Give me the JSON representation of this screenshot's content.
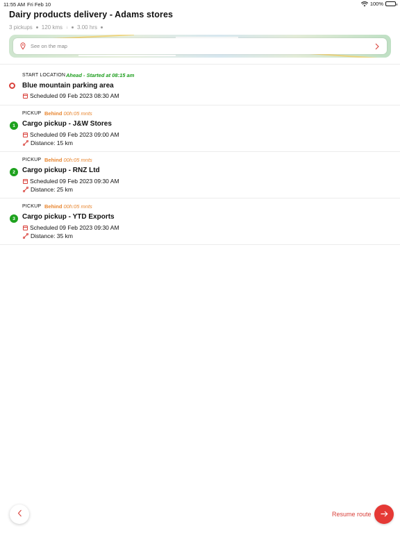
{
  "status_bar": {
    "time": "11:55 AM",
    "date": "Fri Feb 10",
    "battery": "100%"
  },
  "header": {
    "title": "Dairy products delivery - Adams stores",
    "pickups": "3 pickups",
    "distance": "120 kms",
    "duration": "3.00 hrs"
  },
  "map": {
    "placeholder": "See on the map"
  },
  "start": {
    "label": "START LOCATION",
    "status": "Ahead - Started at 08:15 am",
    "title": "Blue mountain parking area",
    "scheduled": "Scheduled 09 Feb 2023 08:30 AM"
  },
  "stops": [
    {
      "number": "1",
      "label": "PICKUP",
      "status_word": "Behind",
      "status_time": "00h:05 mnts",
      "title": "Cargo pickup - J&W Stores",
      "scheduled": "Scheduled 09 Feb 2023 09:00 AM",
      "distance": "Distance: 15 km"
    },
    {
      "number": "2",
      "label": "PICKUP",
      "status_word": "Behind",
      "status_time": "00h:05 mnts",
      "title": "Cargo pickup - RNZ Ltd",
      "scheduled": "Scheduled 09 Feb 2023 09:30 AM",
      "distance": "Distance: 25 km"
    },
    {
      "number": "3",
      "label": "PICKUP",
      "status_word": "Behind",
      "status_time": "00h:05 mnts",
      "title": "Cargo pickup - YTD Exports",
      "scheduled": "Scheduled 09 Feb 2023 09:30 AM",
      "distance": "Distance: 35 km"
    }
  ],
  "footer": {
    "resume_label": "Resume route"
  },
  "colors": {
    "accent": "#e53935",
    "ahead": "#1e9e1e",
    "behind": "#e8852e",
    "badge": "#1ea21e"
  }
}
